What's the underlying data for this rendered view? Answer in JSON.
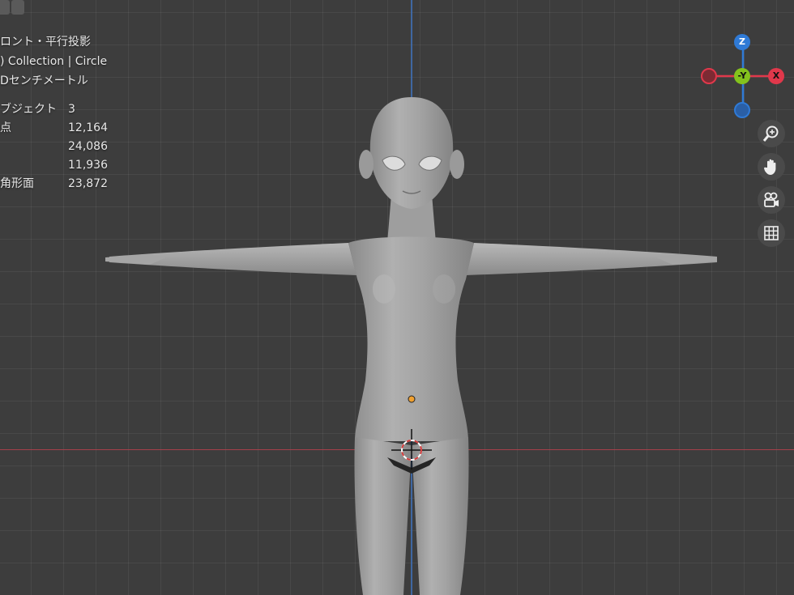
{
  "header": {
    "icons": [
      "view-layout-icon",
      "select-box-icon"
    ]
  },
  "overlay": {
    "view_name": "ロント・平行投影",
    "collection": ") Collection | Circle",
    "units": "Dセンチメートル"
  },
  "stats": [
    {
      "label": "ブジェクト",
      "value": "3"
    },
    {
      "label": "点",
      "value": "12,164"
    },
    {
      "label": "",
      "value": "24,086"
    },
    {
      "label": "",
      "value": "11,936"
    },
    {
      "label": "角形面",
      "value": "23,872"
    }
  ],
  "gizmo": {
    "z_label": "Z",
    "y_label": "-Y",
    "x_label": "X",
    "colors": {
      "z": "#2f7ad6",
      "y": "#84c21d",
      "x": "#e0384b"
    }
  },
  "nav_buttons": [
    {
      "name": "zoom-icon"
    },
    {
      "name": "pan-hand-icon"
    },
    {
      "name": "camera-view-icon"
    },
    {
      "name": "ortho-grid-icon"
    }
  ],
  "colors": {
    "background": "#3d3d3d",
    "model": "#9c9c9c",
    "origin": "#f0a030",
    "cursor_ring": "#d43c3c"
  }
}
